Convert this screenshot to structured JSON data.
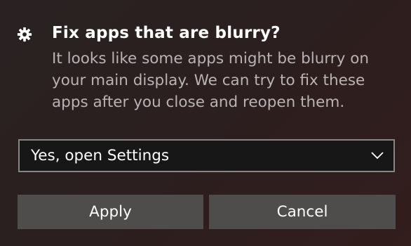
{
  "dialog": {
    "icon": "gear-icon",
    "title": "Fix apps that are blurry?",
    "body_lines": [
      "It looks like some apps might be blurry on",
      "your main display. We can try to fix these",
      "apps after you close and reopen them."
    ]
  },
  "dropdown": {
    "selected": "Yes, open Settings",
    "icon": "chevron-down-icon"
  },
  "buttons": {
    "apply": "Apply",
    "cancel": "Cancel"
  },
  "colors": {
    "background": "#2b1f1f",
    "button": "#4f4c4c",
    "dropdown_border": "#8a8585",
    "body_text": "#b9b3b3"
  }
}
